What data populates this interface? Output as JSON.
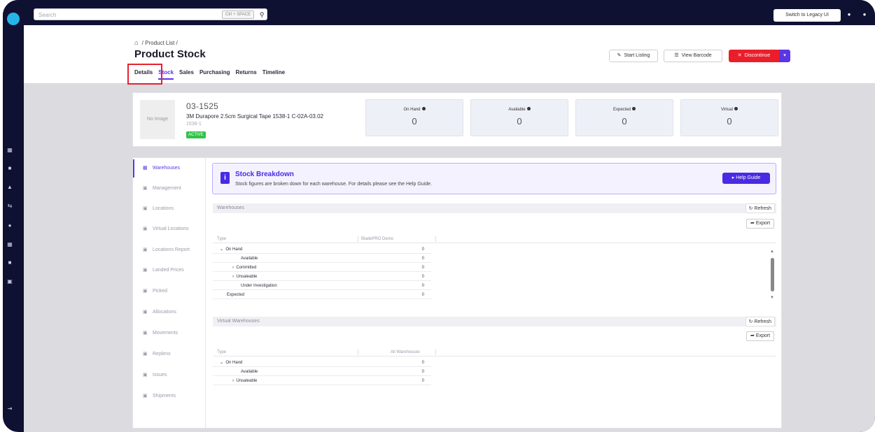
{
  "topbar": {
    "search_placeholder": "Search",
    "shortcut": "Ctrl + SPACE",
    "legacy_label": "Switch to Legacy UI"
  },
  "breadcrumb": {
    "items": [
      "Product List",
      "/"
    ],
    "sep": "/"
  },
  "page_title": "Product Stock",
  "tabs": [
    "Details",
    "Stock",
    "Sales",
    "Purchasing",
    "Returns",
    "Timeline"
  ],
  "actions": {
    "start_listing": "Start Listing",
    "view_barcode": "View Barcode",
    "discontinue": "Discontinue"
  },
  "product": {
    "no_image": "No Image",
    "sku": "03-1525",
    "name": "3M Durapore 2.5cm Surgical Tape 1538-1 C-02A-03.02",
    "sub_sku": "1538-1",
    "status": "ACTIVE"
  },
  "stats": [
    {
      "label": "On Hand",
      "value": "0"
    },
    {
      "label": "Available",
      "value": "0"
    },
    {
      "label": "Expected",
      "value": "0"
    },
    {
      "label": "Virtual",
      "value": "0"
    }
  ],
  "subnav": [
    "Warehouses",
    "Management",
    "Locations",
    "Virtual Locations",
    "Locations Report",
    "Landed Prices",
    "Picked",
    "Allocations",
    "Movements",
    "Replens",
    "Issues",
    "Shipments"
  ],
  "banner": {
    "title": "Stock Breakdown",
    "text": "Stock figures are broken down for each warehouse. For details please see the Help Guide.",
    "help": "Help Guide"
  },
  "warehouses": {
    "title": "Warehouses",
    "refresh": "Refresh",
    "export": "Export",
    "col_type": "Type",
    "col_wh": "BladePRO Demo",
    "rows": [
      {
        "label": "On Hand",
        "value": "0"
      },
      {
        "label": "Available",
        "value": "0"
      },
      {
        "label": "Committed",
        "value": "0"
      },
      {
        "label": "Unsaleable",
        "value": "0"
      },
      {
        "label": "Under Investigation",
        "value": "0"
      },
      {
        "label": "Expected",
        "value": "0"
      }
    ]
  },
  "virtual": {
    "title": "Virtual Warehouses",
    "refresh": "Refresh",
    "export": "Export",
    "col_type": "Type",
    "col_wh": "All Warehouses",
    "rows": [
      {
        "label": "On Hand",
        "value": "0"
      },
      {
        "label": "Available",
        "value": "0"
      },
      {
        "label": "Unsaleable",
        "value": "0"
      }
    ]
  },
  "colors": {
    "accent": "#5a36e6",
    "danger": "#ea1e2b",
    "success": "#2fc348",
    "nav": "#0f1132"
  }
}
